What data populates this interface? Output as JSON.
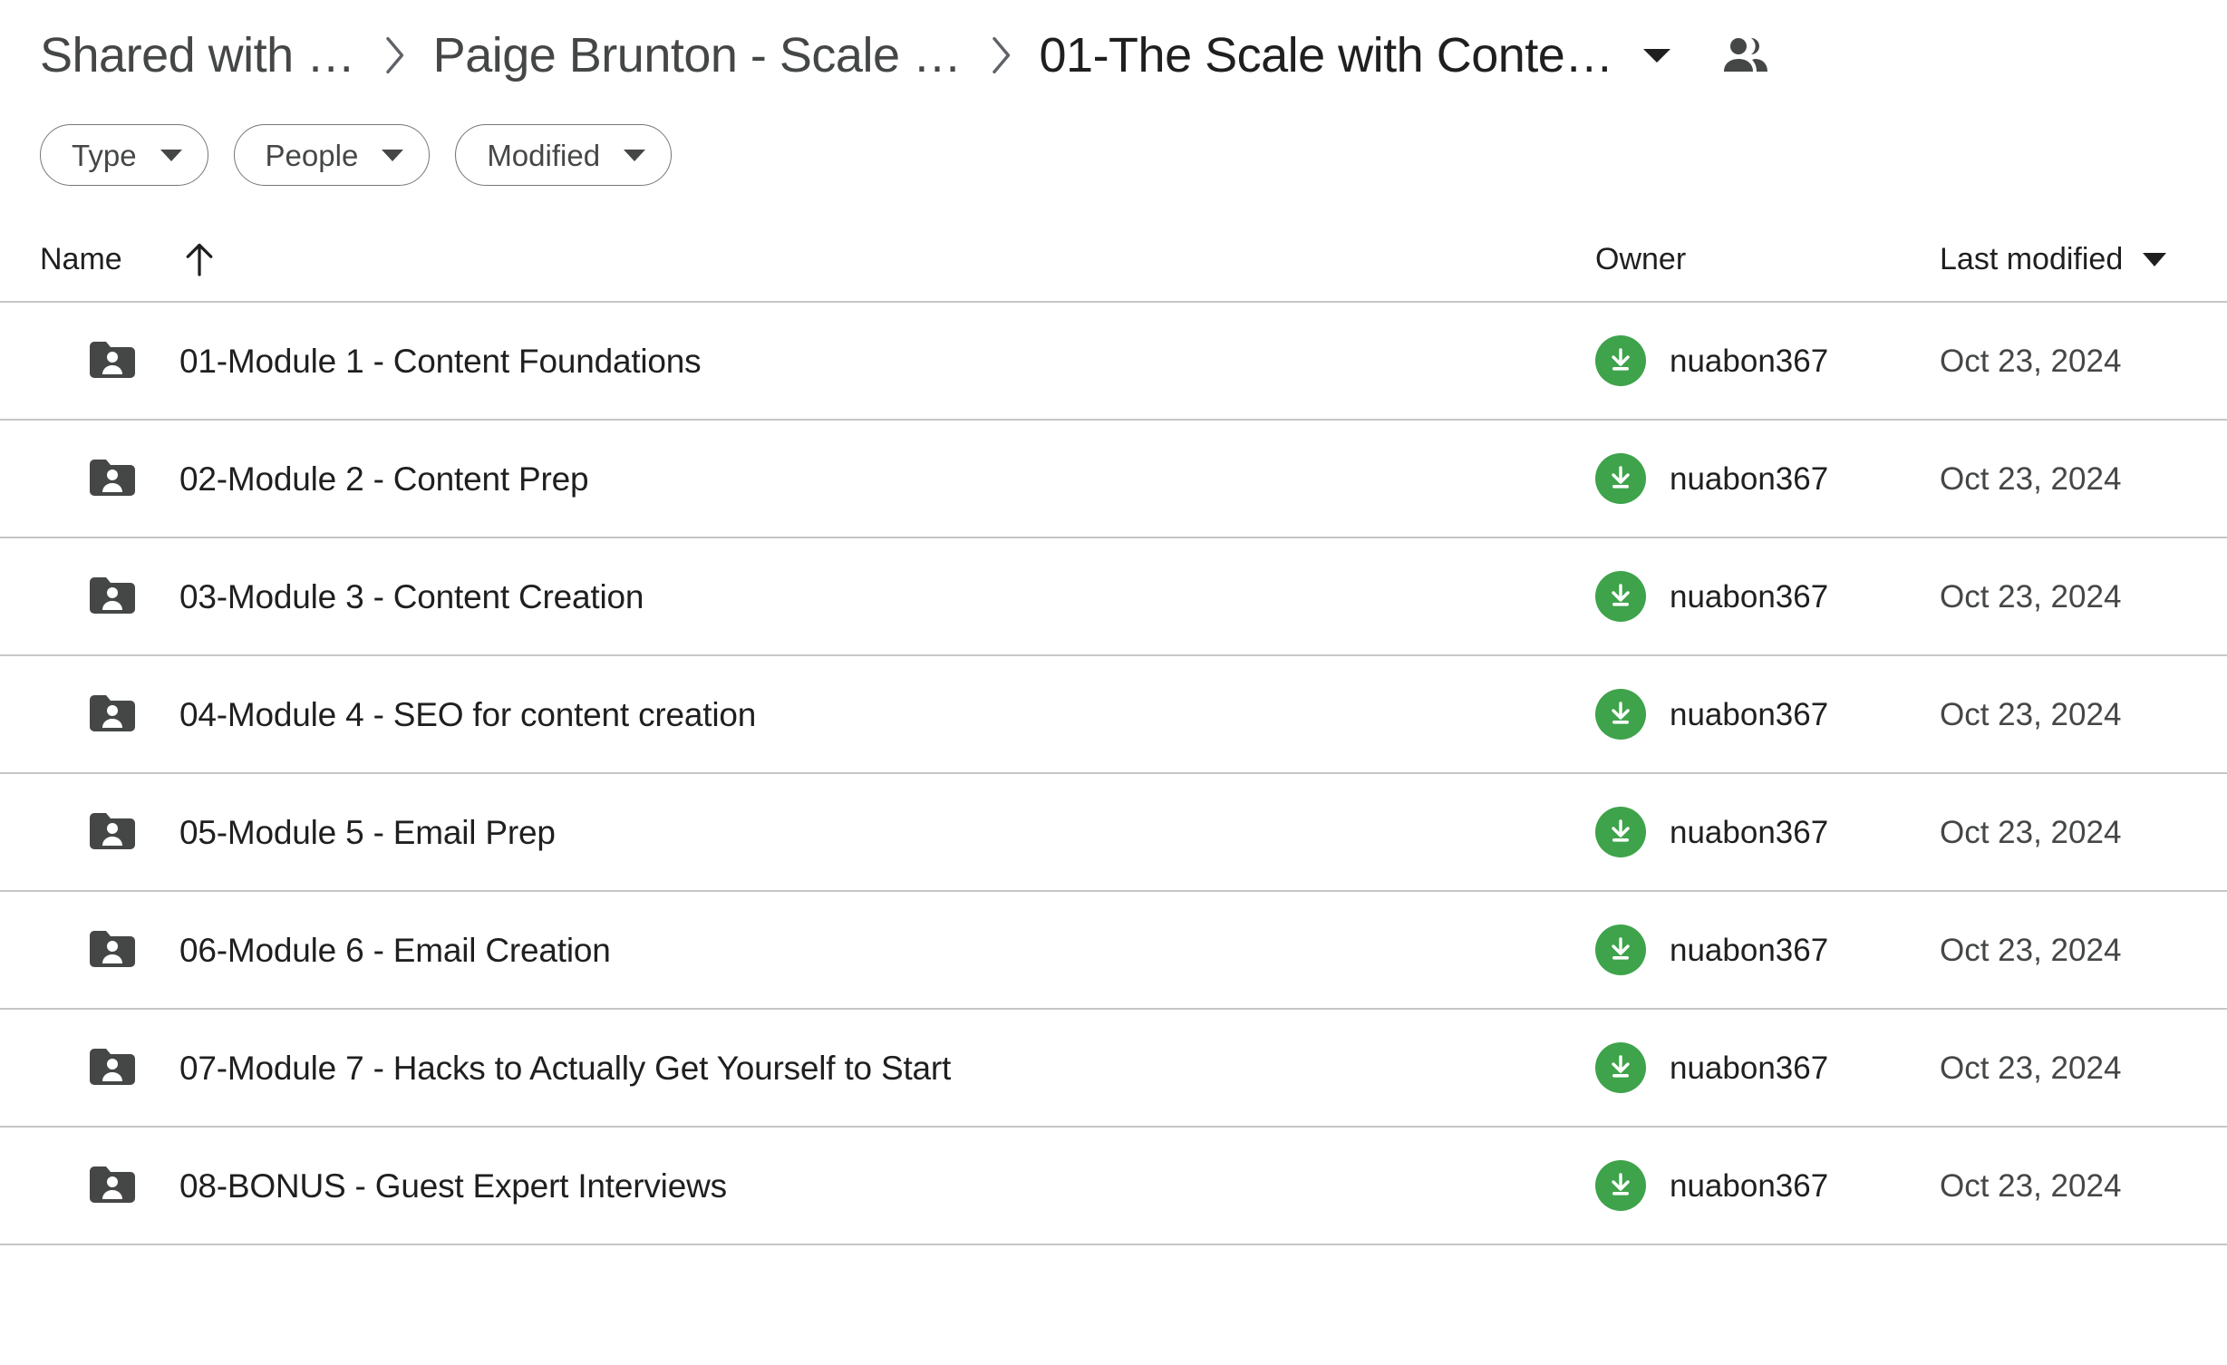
{
  "breadcrumb": {
    "items": [
      {
        "label": "Shared with …",
        "current": false
      },
      {
        "label": "Paige Brunton - Scale …",
        "current": false
      },
      {
        "label": "01-The Scale with Conte…",
        "current": true
      }
    ],
    "separator_icon": "chevron-right-icon",
    "caret_icon": "caret-down-icon",
    "people_icon": "people-shared-icon"
  },
  "filters": [
    {
      "label": "Type",
      "caret": "caret-down-icon"
    },
    {
      "label": "People",
      "caret": "caret-down-icon"
    },
    {
      "label": "Modified",
      "caret": "caret-down-icon"
    }
  ],
  "table": {
    "headers": {
      "name": "Name",
      "name_sort_icon": "arrow-up-icon",
      "owner": "Owner",
      "last_modified": "Last modified",
      "modified_sort_icon": "caret-down-icon"
    },
    "rows": [
      {
        "icon": "shared-folder-icon",
        "name": "01-Module 1 - Content Foundations",
        "owner": "nuabon367",
        "owner_avatar_icon": "download-arrow-icon",
        "modified": "Oct 23, 2024"
      },
      {
        "icon": "shared-folder-icon",
        "name": "02-Module 2 - Content Prep",
        "owner": "nuabon367",
        "owner_avatar_icon": "download-arrow-icon",
        "modified": "Oct 23, 2024"
      },
      {
        "icon": "shared-folder-icon",
        "name": "03-Module 3 - Content Creation",
        "owner": "nuabon367",
        "owner_avatar_icon": "download-arrow-icon",
        "modified": "Oct 23, 2024"
      },
      {
        "icon": "shared-folder-icon",
        "name": "04-Module 4 - SEO for content creation",
        "owner": "nuabon367",
        "owner_avatar_icon": "download-arrow-icon",
        "modified": "Oct 23, 2024"
      },
      {
        "icon": "shared-folder-icon",
        "name": "05-Module 5 - Email Prep",
        "owner": "nuabon367",
        "owner_avatar_icon": "download-arrow-icon",
        "modified": "Oct 23, 2024"
      },
      {
        "icon": "shared-folder-icon",
        "name": "06-Module 6 - Email Creation",
        "owner": "nuabon367",
        "owner_avatar_icon": "download-arrow-icon",
        "modified": "Oct 23, 2024"
      },
      {
        "icon": "shared-folder-icon",
        "name": "07-Module 7 - Hacks to Actually Get Yourself to Start",
        "owner": "nuabon367",
        "owner_avatar_icon": "download-arrow-icon",
        "modified": "Oct 23, 2024"
      },
      {
        "icon": "shared-folder-icon",
        "name": "08-BONUS - Guest Expert Interviews",
        "owner": "nuabon367",
        "owner_avatar_icon": "download-arrow-icon",
        "modified": "Oct 23, 2024"
      }
    ]
  },
  "colors": {
    "avatar_green": "#3ea34a",
    "folder_gray": "#444746",
    "text_primary": "#1f1f1f",
    "text_secondary": "#444746",
    "divider": "#c4c7c5",
    "chip_border": "#747775"
  }
}
